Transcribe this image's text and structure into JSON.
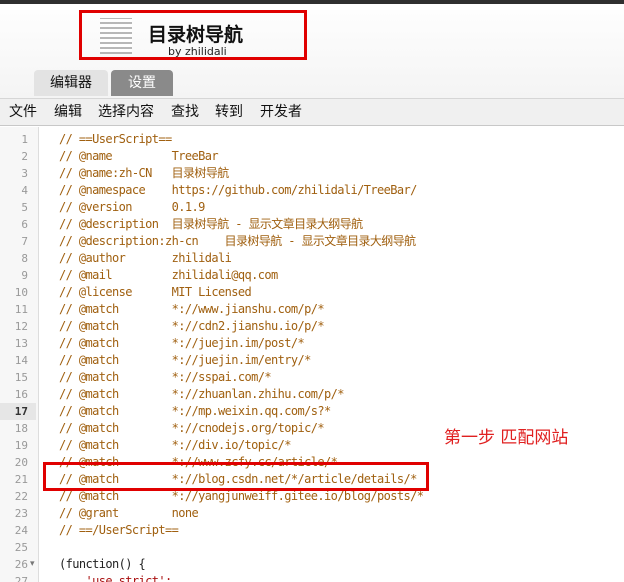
{
  "header": {
    "title": "目录树导航",
    "author": "by zhilidali"
  },
  "tabs": [
    {
      "label": "编辑器",
      "active": true
    },
    {
      "label": "设置",
      "active": false
    }
  ],
  "menu": [
    "文件",
    "编辑",
    "选择内容",
    "查找",
    "转到",
    "开发者"
  ],
  "editor": {
    "active_line": 17,
    "lines": [
      {
        "n": "1",
        "text": "// ==UserScript=="
      },
      {
        "n": "2",
        "text": "// @name         TreeBar"
      },
      {
        "n": "3",
        "text": "// @name:zh-CN   目录树导航"
      },
      {
        "n": "4",
        "text": "// @namespace    https://github.com/zhilidali/TreeBar/"
      },
      {
        "n": "5",
        "text": "// @version      0.1.9"
      },
      {
        "n": "6",
        "text": "// @description  目录树导航 - 显示文章目录大纲导航"
      },
      {
        "n": "7",
        "text": "// @description:zh-cn    目录树导航 - 显示文章目录大纲导航"
      },
      {
        "n": "8",
        "text": "// @author       zhilidali"
      },
      {
        "n": "9",
        "text": "// @mail         zhilidali@qq.com"
      },
      {
        "n": "10",
        "text": "// @license      MIT Licensed"
      },
      {
        "n": "11",
        "text": "// @match        *://www.jianshu.com/p/*"
      },
      {
        "n": "12",
        "text": "// @match        *://cdn2.jianshu.io/p/*"
      },
      {
        "n": "13",
        "text": "// @match        *://juejin.im/post/*"
      },
      {
        "n": "14",
        "text": "// @match        *://juejin.im/entry/*"
      },
      {
        "n": "15",
        "text": "// @match        *://sspai.com/*"
      },
      {
        "n": "16",
        "text": "// @match        *://zhuanlan.zhihu.com/p/*"
      },
      {
        "n": "17",
        "text": "// @match        *://mp.weixin.qq.com/s?*"
      },
      {
        "n": "18",
        "text": "// @match        *://cnodejs.org/topic/*"
      },
      {
        "n": "19",
        "text": "// @match        *://div.io/topic/*"
      },
      {
        "n": "20",
        "text": "// @match        *://www.zcfy.cc/article/*"
      },
      {
        "n": "21",
        "text": "// @match        *://blog.csdn.net/*/article/details/*"
      },
      {
        "n": "22",
        "text": "// @match        *://yangjunweiff.gitee.io/blog/posts/*"
      },
      {
        "n": "23",
        "text": "// @grant        none"
      },
      {
        "n": "24",
        "text": "// ==/UserScript=="
      },
      {
        "n": "25",
        "text": ""
      },
      {
        "n": "26",
        "text": "(function() {"
      },
      {
        "n": "27",
        "text": "    'use strict';"
      }
    ]
  },
  "annotation": "第一步 匹配网站",
  "colors": {
    "highlight_border": "#e00000",
    "annotation": "#e02020",
    "comment": "#a06010"
  }
}
